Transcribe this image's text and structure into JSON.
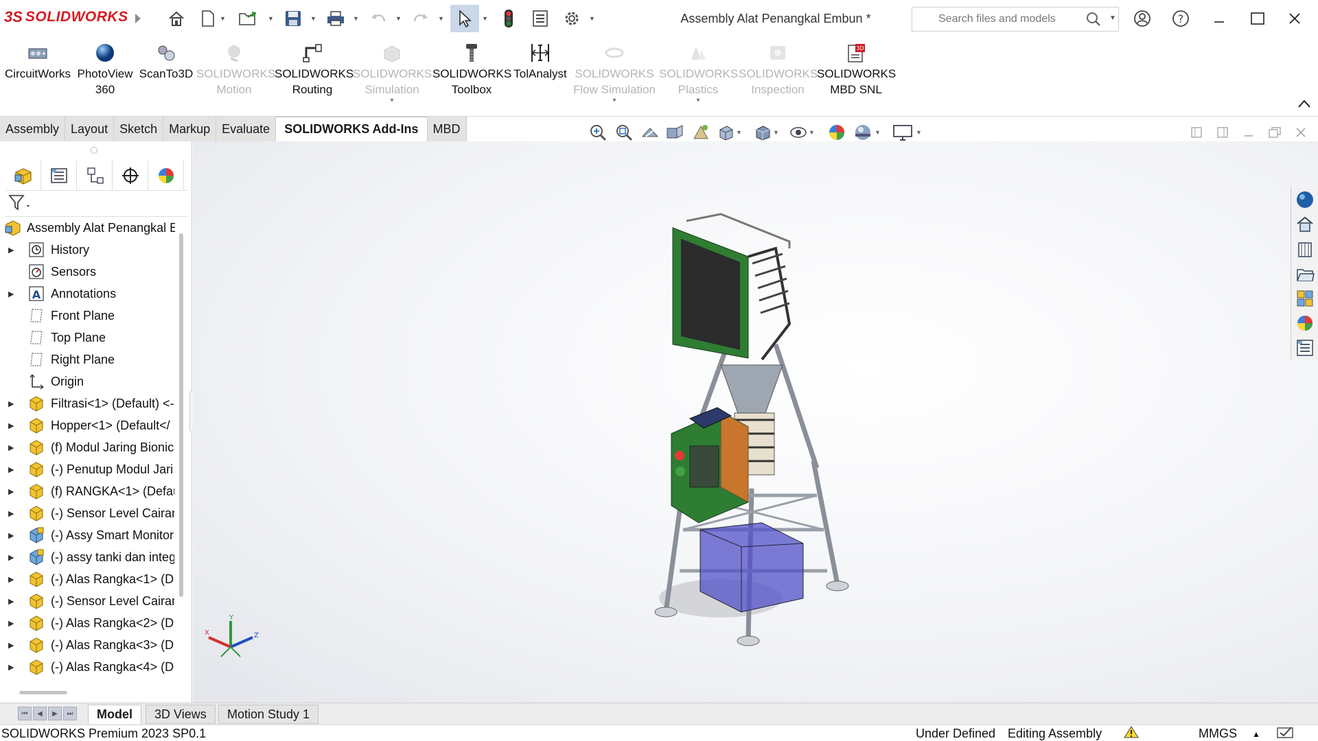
{
  "app": {
    "brand_ds": "3S",
    "brand_name": "SOLIDWORKS",
    "document_title": "Assembly Alat Penangkal Embun *"
  },
  "search": {
    "placeholder": "Search files and models"
  },
  "quick_access": [
    "home-icon",
    "new-document-icon",
    "open-icon",
    "save-icon",
    "print-icon",
    "undo-icon",
    "redo-icon",
    "select-pointer-icon",
    "rebuild-traffic-light-icon",
    "file-properties-icon",
    "options-gear-icon"
  ],
  "addins": [
    {
      "line1": "CircuitWorks",
      "line2": "",
      "enabled": true,
      "icon": "circuitworks-icon"
    },
    {
      "line1": "PhotoView",
      "line2": "360",
      "enabled": true,
      "icon": "photoview-sphere-icon"
    },
    {
      "line1": "ScanTo3D",
      "line2": "",
      "enabled": true,
      "icon": "scanto3d-icon"
    },
    {
      "line1": "SOLIDWORKS",
      "line2": "Motion",
      "enabled": false,
      "icon": "motion-icon"
    },
    {
      "line1": "SOLIDWORKS",
      "line2": "Routing",
      "enabled": true,
      "icon": "routing-icon"
    },
    {
      "line1": "SOLIDWORKS",
      "line2": "Simulation",
      "enabled": false,
      "icon": "simulation-icon"
    },
    {
      "line1": "SOLIDWORKS",
      "line2": "Toolbox",
      "enabled": true,
      "icon": "toolbox-icon"
    },
    {
      "line1": "TolAnalyst",
      "line2": "",
      "enabled": true,
      "icon": "tolanalyst-icon"
    },
    {
      "line1": "SOLIDWORKS",
      "line2": "Flow Simulation",
      "enabled": false,
      "icon": "flow-simulation-icon"
    },
    {
      "line1": "SOLIDWORKS",
      "line2": "Plastics",
      "enabled": false,
      "icon": "plastics-icon"
    },
    {
      "line1": "SOLIDWORKS",
      "line2": "Inspection",
      "enabled": false,
      "icon": "inspection-icon"
    },
    {
      "line1": "SOLIDWORKS",
      "line2": "MBD SNL",
      "enabled": true,
      "icon": "mbd-snl-icon"
    }
  ],
  "tabs": [
    "Assembly",
    "Layout",
    "Sketch",
    "Markup",
    "Evaluate",
    "SOLIDWORKS Add-Ins",
    "MBD"
  ],
  "active_tab": "SOLIDWORKS Add-Ins",
  "feature_tree": {
    "root": "Assembly Alat Penangkal E",
    "items": [
      {
        "label": "History",
        "expandable": true,
        "icon": "history-icon"
      },
      {
        "label": "Sensors",
        "expandable": false,
        "icon": "sensors-icon"
      },
      {
        "label": "Annotations",
        "expandable": true,
        "icon": "annotations-icon"
      },
      {
        "label": "Front Plane",
        "expandable": false,
        "icon": "plane-icon"
      },
      {
        "label": "Top Plane",
        "expandable": false,
        "icon": "plane-icon"
      },
      {
        "label": "Right Plane",
        "expandable": false,
        "icon": "plane-icon"
      },
      {
        "label": "Origin",
        "expandable": false,
        "icon": "origin-icon"
      },
      {
        "label": "Filtrasi<1> (Default) <-",
        "expandable": true,
        "icon": "subassembly-icon"
      },
      {
        "label": "Hopper<1> (Default</",
        "expandable": true,
        "icon": "subassembly-icon"
      },
      {
        "label": "(f) Modul Jaring Bionic",
        "expandable": true,
        "icon": "subassembly-icon"
      },
      {
        "label": "(-) Penutup Modul Jari",
        "expandable": true,
        "icon": "subassembly-icon"
      },
      {
        "label": "(f) RANGKA<1> (Defau",
        "expandable": true,
        "icon": "subassembly-icon"
      },
      {
        "label": "(-) Sensor Level Cairan",
        "expandable": true,
        "icon": "subassembly-icon"
      },
      {
        "label": "(-) Assy Smart Monitor",
        "expandable": true,
        "icon": "subassembly-blue-icon"
      },
      {
        "label": "(-) assy tanki dan integ",
        "expandable": true,
        "icon": "subassembly-blue-icon"
      },
      {
        "label": "(-) Alas Rangka<1> (D",
        "expandable": true,
        "icon": "subassembly-icon"
      },
      {
        "label": "(-) Sensor Level Cairan",
        "expandable": true,
        "icon": "subassembly-icon"
      },
      {
        "label": "(-) Alas Rangka<2> (D",
        "expandable": true,
        "icon": "subassembly-icon"
      },
      {
        "label": "(-) Alas Rangka<3> (D",
        "expandable": true,
        "icon": "subassembly-icon"
      },
      {
        "label": "(-) Alas Rangka<4> (D",
        "expandable": true,
        "icon": "subassembly-icon"
      }
    ]
  },
  "bottom_tabs": [
    "Model",
    "3D Views",
    "Motion Study 1"
  ],
  "status": {
    "version": "SOLIDWORKS Premium 2023 SP0.1",
    "definition": "Under Defined",
    "mode": "Editing Assembly",
    "units": "MMGS"
  },
  "triad_labels": {
    "x": "X",
    "y": "Y",
    "z": "Z"
  },
  "colors": {
    "brand_red": "#d51b21",
    "frame_green": "#2e7d32",
    "tank_blue": "#5050c8"
  }
}
